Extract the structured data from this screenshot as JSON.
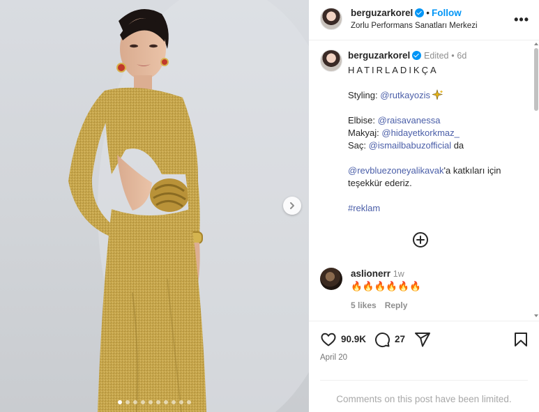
{
  "post": {
    "author": "berguzarkorel",
    "follow_label": "Follow",
    "separator": "•",
    "location": "Zorlu Performans Sanatları Merkezi",
    "more_label": "•••",
    "carousel": {
      "count": 10,
      "active_index": 0
    }
  },
  "caption": {
    "author": "berguzarkorel",
    "edited": "Edited",
    "separator": "•",
    "time": "6d",
    "title": "HATIRLADIKÇA",
    "styling_prefix": "Styling: ",
    "styling_handle": "@rutkayozis",
    "dress_prefix": "Elbise: ",
    "dress_handle": "@raisavanessa",
    "makeup_prefix": "Makyaj: ",
    "makeup_handle": "@hidayetkorkmaz_",
    "hair_prefix": "Saç: ",
    "hair_handle": "@ismailbabuzofficial",
    "hair_suffix": " da",
    "venue_handle": "@revbluezoneyalikavak",
    "venue_suffix": "'a katkıları için",
    "thanks": "teşekkür ederiz.",
    "hashtag": "#reklam"
  },
  "comment": {
    "author": "aslionerr",
    "time": "1w",
    "text": "🔥🔥🔥🔥🔥🔥",
    "likes": "5 likes",
    "reply": "Reply"
  },
  "stats": {
    "likes": "90.9K",
    "comments": "27",
    "date": "April 20",
    "comments_limited": "Comments on this post have been limited."
  },
  "colors": {
    "accent": "#0095f6",
    "link": "#4a5ea8",
    "muted": "#8e8e8e",
    "dress_gold": "#c9a84a"
  }
}
